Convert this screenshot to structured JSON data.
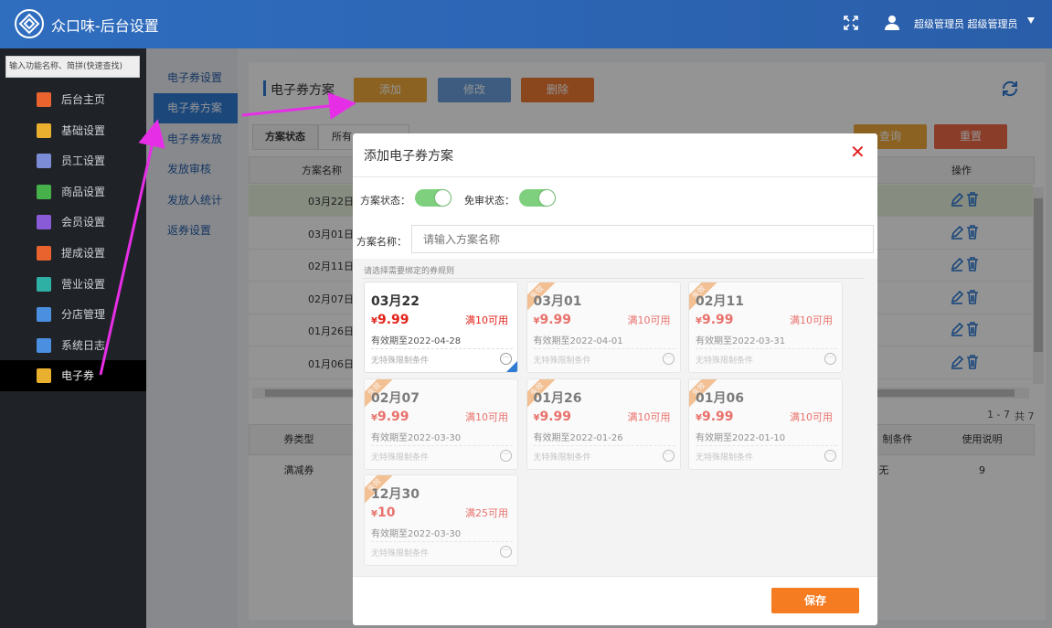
{
  "header": {
    "title": "众口味-后台设置",
    "user": "超级管理员 超级管理员"
  },
  "sidebar": {
    "search_placeholder": "输入功能名称、简拼(快速查找)",
    "items": [
      {
        "label": "后台主页",
        "icon": "home-icon",
        "color": "#e8632e"
      },
      {
        "label": "基础设置",
        "icon": "settings-icon",
        "color": "#e8b02e"
      },
      {
        "label": "员工设置",
        "icon": "staff-icon",
        "color": "#7d8cd6"
      },
      {
        "label": "商品设置",
        "icon": "goods-icon",
        "color": "#46b04a"
      },
      {
        "label": "会员设置",
        "icon": "crown-icon",
        "color": "#8a5bd6"
      },
      {
        "label": "提成设置",
        "icon": "chart-icon",
        "color": "#e8632e"
      },
      {
        "label": "营业设置",
        "icon": "store-icon",
        "color": "#2fb0a5"
      },
      {
        "label": "分店管理",
        "icon": "branch-icon",
        "color": "#4a8fe0"
      },
      {
        "label": "系统日志",
        "icon": "log-icon",
        "color": "#4a8fe0"
      },
      {
        "label": "电子券",
        "icon": "coupon-icon",
        "color": "#e8b02e"
      }
    ]
  },
  "subnav": {
    "items": [
      "电子券设置",
      "电子券方案",
      "电子券发放",
      "发放审核",
      "发放人统计",
      "返券设置"
    ]
  },
  "main": {
    "title": "电子券方案",
    "add": "添加",
    "edit": "修改",
    "delete": "删除",
    "filter_label": "方案状态",
    "filter_value": "所有",
    "query": "查询",
    "reset": "重置",
    "col_name": "方案名称",
    "col_ops": "操作",
    "rows": [
      "03月22日",
      "03月01日",
      "02月11日",
      "02月07日",
      "01月26日",
      "01月06日"
    ],
    "pager": "1 - 7",
    "total": "共 7 条",
    "bottom_headers": [
      "券类型",
      "制条件",
      "使用说明"
    ],
    "bottom_row": [
      "满减券",
      "无",
      "9"
    ]
  },
  "modal": {
    "title": "添加电子券方案",
    "status_label": "方案状态：",
    "audit_label": "免审状态：",
    "name_label": "方案名称：",
    "name_placeholder": "请输入方案名称",
    "section_label": "请选择需要绑定的券规则",
    "save": "保存",
    "coupons": [
      {
        "date": "03月22",
        "price": "9.99",
        "threshold": "满10可用",
        "valid": "有效期至2022-04-28",
        "note": "无特殊限制条件",
        "disabled": false,
        "selected": true
      },
      {
        "date": "03月01",
        "price": "9.99",
        "threshold": "满10可用",
        "valid": "有效期至2022-04-01",
        "note": "无特殊限制条件",
        "disabled": true
      },
      {
        "date": "02月11",
        "price": "9.99",
        "threshold": "满10可用",
        "valid": "有效期至2022-03-31",
        "note": "无特殊限制条件",
        "disabled": true
      },
      {
        "date": "02月07",
        "price": "9.99",
        "threshold": "满10可用",
        "valid": "有效期至2022-03-30",
        "note": "无特殊限制条件",
        "disabled": true
      },
      {
        "date": "01月26",
        "price": "9.99",
        "threshold": "满10可用",
        "valid": "有效期至2022-01-26",
        "note": "无特殊限制条件",
        "disabled": true
      },
      {
        "date": "01月06",
        "price": "9.99",
        "threshold": "满10可用",
        "valid": "有效期至2022-01-10",
        "note": "无特殊限制条件",
        "disabled": true
      },
      {
        "date": "12月30",
        "price": "10",
        "threshold": "满25可用",
        "valid": "有效期至2022-03-30",
        "note": "无特殊限制条件",
        "disabled": true
      }
    ],
    "ribbon_text": "失效",
    "currency": "¥"
  },
  "colors": {
    "accent": "#2f7bd4",
    "add": "#f0a93b",
    "edit": "#6a9fdb",
    "delete": "#ee7a35",
    "save": "#f57c20",
    "arrow": "#e72ee7"
  }
}
